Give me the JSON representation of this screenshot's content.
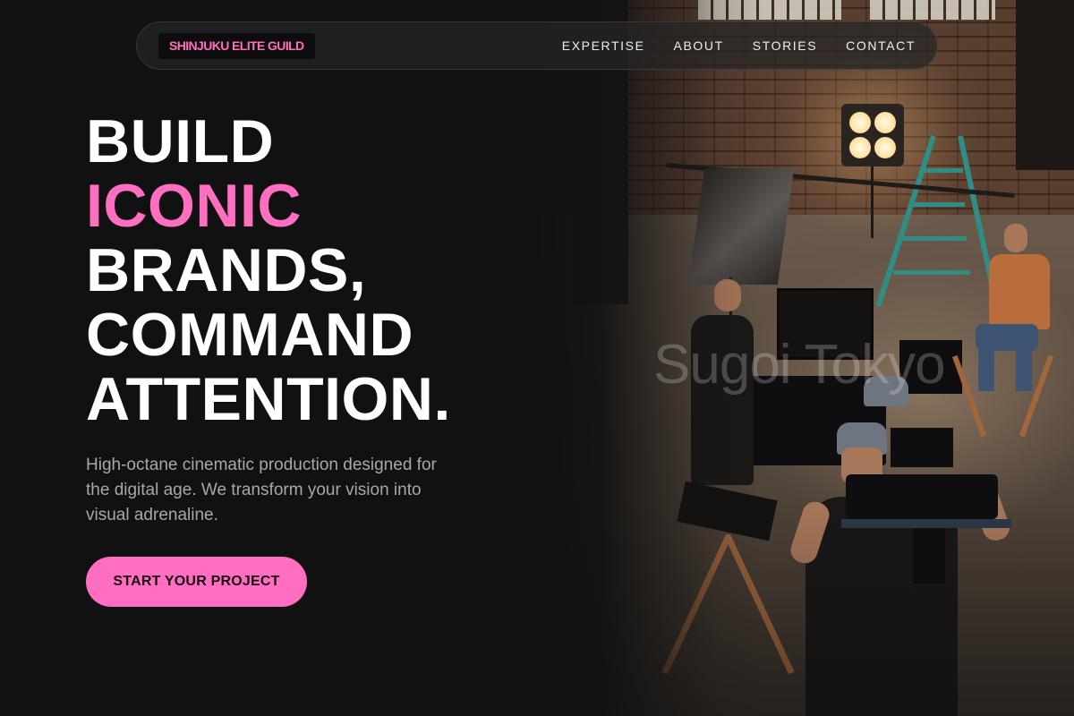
{
  "nav": {
    "logo": "SHINJUKU ELITE GUILD",
    "links": [
      "EXPERTISE",
      "ABOUT",
      "STORIES",
      "CONTACT"
    ]
  },
  "hero": {
    "headline_lines": [
      "BUILD",
      "ICONIC",
      "BRANDS,",
      "COMMAND",
      "ATTENTION."
    ],
    "subtext": "High-octane cinematic production designed for the digital age. We transform your vision into visual adrenaline.",
    "cta_label": "START YOUR PROJECT",
    "image_watermark": "Sugoi Tokyo"
  },
  "colors": {
    "background": "#111111",
    "accent": "#ff6ec0",
    "headline": "#ffffff",
    "subtext": "#a7a7ad",
    "logo_text": "#ff6fbf"
  }
}
